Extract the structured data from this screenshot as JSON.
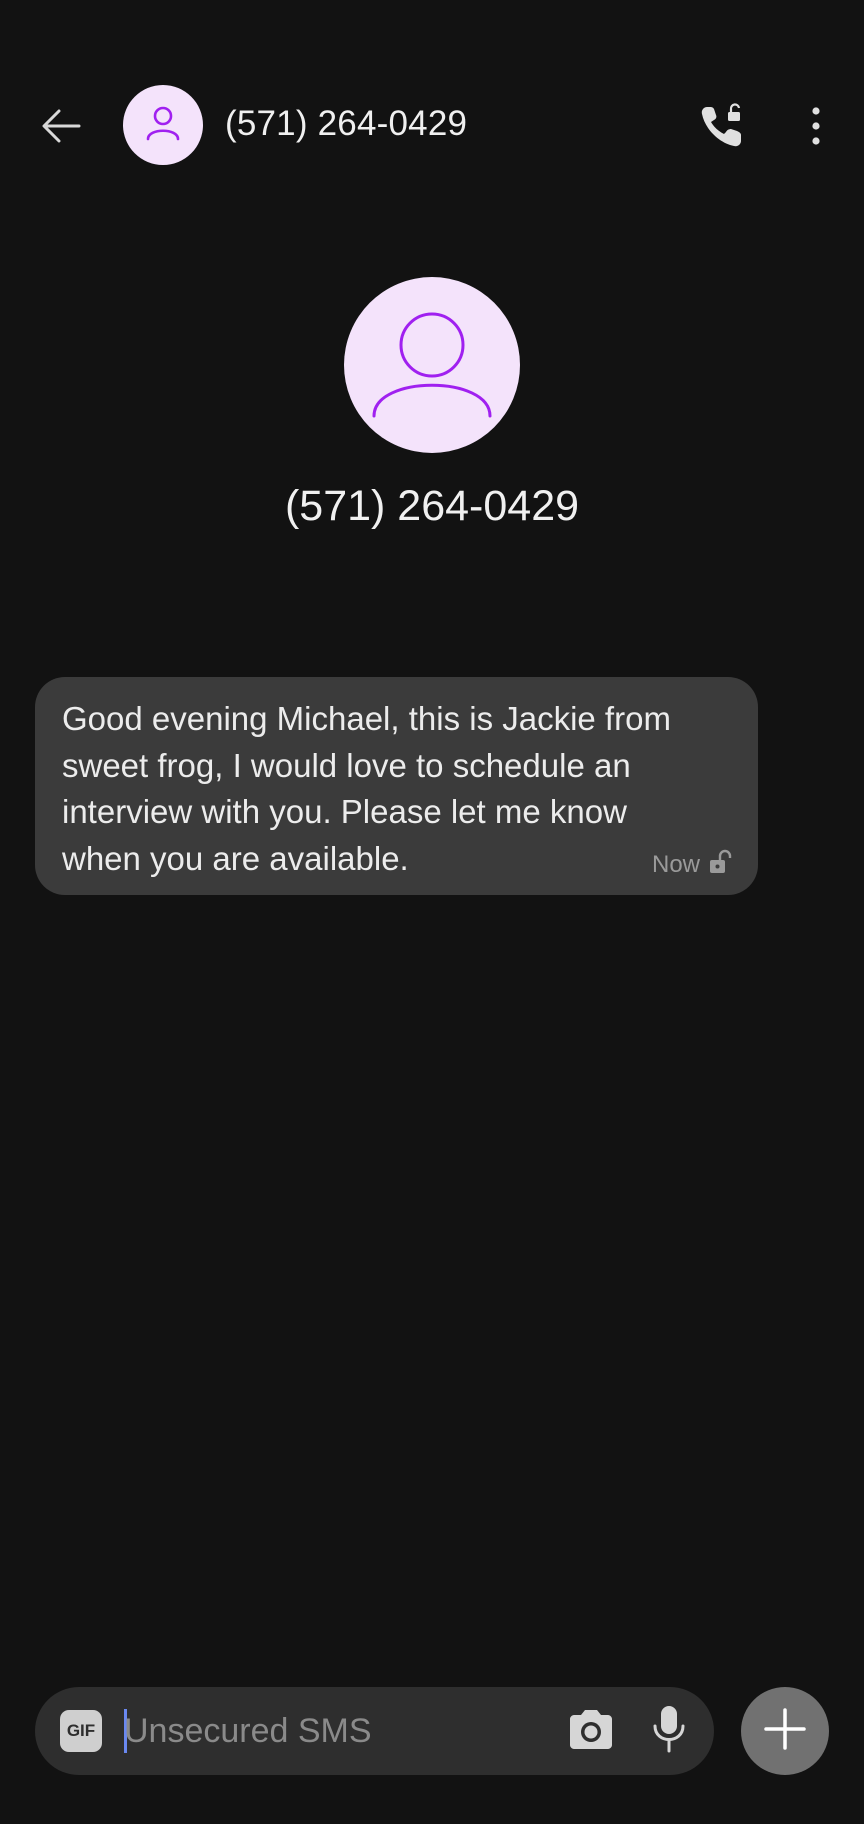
{
  "header": {
    "title": "(571) 264-0429",
    "back_icon": "arrow-back-icon",
    "avatar_icon": "person-icon",
    "call_icon": "phone-call-icon",
    "menu_icon": "more-vertical-icon"
  },
  "contact": {
    "name": "(571) 264-0429",
    "avatar_icon": "person-icon"
  },
  "messages": [
    {
      "text": "Good evening Michael, this is Jackie from\nsweet frog, I would love to schedule an\ninterview with you. Please let me know\nwhen you are available.",
      "time": "Now",
      "status_icon": "unlocked-icon"
    }
  ],
  "composer": {
    "gif_label": "GIF",
    "placeholder": "Unsecured SMS",
    "camera_icon": "camera-icon",
    "mic_icon": "microphone-icon",
    "add_icon": "plus-icon"
  },
  "colors": {
    "background": "#121212",
    "bubble": "#3b3b3b",
    "avatar_bg": "#f4e3fb",
    "avatar_fg": "#a020f0",
    "cursor": "#6a88f0",
    "add_button": "#717171"
  }
}
